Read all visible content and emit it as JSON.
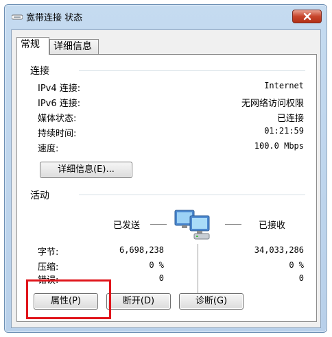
{
  "window": {
    "title": "宽带连接 状态"
  },
  "tabs": [
    {
      "label": "常规"
    },
    {
      "label": "详细信息"
    }
  ],
  "connection": {
    "heading": "连接",
    "rows": [
      {
        "label": "IPv4 连接:",
        "value": "Internet"
      },
      {
        "label": "IPv6 连接:",
        "value": "无网络访问权限"
      },
      {
        "label": "媒体状态:",
        "value": "已连接"
      },
      {
        "label": "持续时间:",
        "value": "01:21:59"
      },
      {
        "label": "速度:",
        "value": "100.0 Mbps"
      }
    ],
    "details_button": "详细信息(E)..."
  },
  "activity": {
    "heading": "活动",
    "sent_label": "已发送",
    "received_label": "已接收",
    "rows": [
      {
        "label": "字节:",
        "sent": "6,698,238",
        "received": "34,033,286"
      },
      {
        "label": "压缩:",
        "sent": "0 %",
        "received": "0 %"
      },
      {
        "label": "错误:",
        "sent": "0",
        "received": "0"
      }
    ]
  },
  "buttons": {
    "properties": "属性(P)",
    "disable": "断开(D)",
    "diagnose": "诊断(G)"
  },
  "colors": {
    "highlight_box": "#e0141a",
    "title_gradient": "#c5dbf0",
    "close_button": "#c7452b"
  }
}
